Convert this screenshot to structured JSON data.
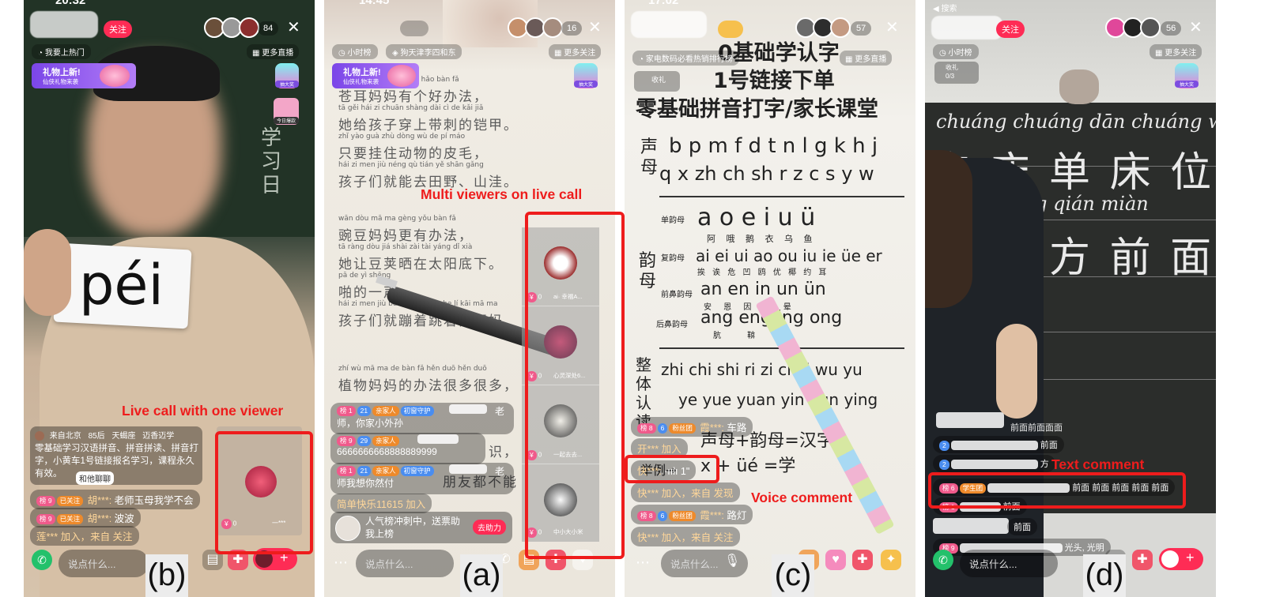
{
  "panel_b": {
    "status_time": "20:32",
    "follow": "关注",
    "viewer_count": "84",
    "trending": "我要上热门",
    "more_live": "更多直播",
    "gift_banner_title": "礼物上新!",
    "gift_banner_sub": "仙侠礼物来袭",
    "lottery": "抽大奖",
    "today_task": "今日爆款",
    "card_word": "péi",
    "label": "Live call with one viewer",
    "profile_tags": [
      "来自北京",
      "85后",
      "天蝎座",
      "迈香迈学"
    ],
    "intro_text": "零基础学习汉语拼音、拼音拼读、拼音打字，小黄车1号链接报名学习，课程永久有效。",
    "chat_with_him": "和他聊聊",
    "comments": [
      {
        "level": "9",
        "badge": "已关注",
        "user": "胡***:",
        "text": "老师玉母我学不会"
      },
      {
        "level": "9",
        "badge": "已关注",
        "user": "胡***:",
        "text": "波波"
      },
      {
        "user": "莲***",
        "text": "加入，来自 关注"
      }
    ],
    "call_tile_count": "0",
    "call_tile_name": "一***",
    "input_placeholder": "说点什么...",
    "subfig": "(b)"
  },
  "panel_a": {
    "status_time": "14:45",
    "viewer_count": "16",
    "tag1": "小时榜",
    "tag2": "狗天津李四和东",
    "more": "更多关注",
    "gift_banner_title": "礼物上新!",
    "gift_banner_sub": "仙侠礼物来袭",
    "lottery": "抽大奖",
    "book_lines": [
      {
        "pinyin": "cāng ěr  mā ma  yǒu gè  hǎo bàn fǎ",
        "text": "苍耳妈妈有个好办法，"
      },
      {
        "pinyin": "tā gěi hái zi chuān shàng dài cì de kǎi jiǎ",
        "text": "她给孩子穿上带刺的铠甲。"
      },
      {
        "pinyin": "zhǐ yào guà zhù dòng wù de pí máo",
        "text": "只要挂住动物的皮毛，"
      },
      {
        "pinyin": "hái zi men jiù néng qù tián yě  shān gǎng",
        "text": "孩子们就能去田野、山洼。"
      },
      {
        "pinyin": "wān dòu mā ma gèng yǒu bàn fǎ",
        "text": "豌豆妈妈更有办法，"
      },
      {
        "pinyin": "tā ràng dòu jiá shài zài tài yáng dǐ xià",
        "text": "她让豆荚晒在太阳底下。"
      },
      {
        "pinyin": "pā de yì shēng",
        "text": "啪的一声，"
      },
      {
        "pinyin": "hái zi men jiù bèng zhe tiào zhe lí kāi mā ma",
        "text": "孩子们就蹦着跳着离开妈"
      },
      {
        "pinyin": "zhí wù mā ma de bàn fǎ hěn duō hěn duō",
        "text": "植物妈妈的办法很多很多，"
      },
      {
        "pinyin": "",
        "text": "识，"
      },
      {
        "pinyin": "",
        "text": "朋友都不能"
      }
    ],
    "label": "Multi viewers on live call",
    "viewer_tiles": [
      {
        "count": "0",
        "name": "ai· 幸福A..."
      },
      {
        "count": "0",
        "name": "心灵深处6..."
      },
      {
        "count": "0",
        "name": "一起去去..."
      },
      {
        "count": "0",
        "name": "中小大小米"
      }
    ],
    "comments": [
      {
        "level": "1",
        "num": "21",
        "badge1": "亲家人",
        "badge2": "初窗守护",
        "tail": "老",
        "text2": "师，你家小外孙"
      },
      {
        "level": "9",
        "num": "29",
        "badge1": "亲家人",
        "text2": "6666666668888889999"
      },
      {
        "level": "1",
        "num": "21",
        "badge1": "亲家人",
        "badge2": "初窗守护",
        "tail": "老",
        "text2": "师我想你然付"
      },
      {
        "text": "简单快乐11615 加入"
      }
    ],
    "rank_banner_text": "人气榜冲刺中，送票助我上榜",
    "rank_banner_btn": "去助力",
    "input_placeholder": "说点什么...",
    "subfig": "(a)"
  },
  "panel_c": {
    "status_time": "17:02",
    "viewer_count": "57",
    "tag1": "家电数码必看热销排行榜",
    "more_live": "更多直播",
    "collect": "收礼",
    "title_line1": "0基础学认字",
    "title_line2": "1号链接下单",
    "title_line3": "零基础拼音打字/家长课堂",
    "sheng_label": "声母",
    "sheng_row1": "b p m f d t n l g k h j",
    "sheng_row2": "q x zh ch sh r z c s y w",
    "yun_label": "韵母",
    "dan_label": "单韵母",
    "dan_row": "a  o  e  i  u  ü",
    "dan_sub": "阿  哦  鹅  衣  乌  鱼",
    "fu_label": "复韵母",
    "fu_row": "ai ei ui ao ou iu ie üe er",
    "fu_sub": "挨 诶 危 凹 鸥 优 椰 约 耳",
    "qian_label": "前鼻韵母",
    "qian_row": "an  en  in  un  ün",
    "qian_sub": "安  恩  因  温  晕",
    "hou_label": "后鼻韵母",
    "hou_row": "ang  eng  ing  ong",
    "hou_sub": "肮  鞥  鹰",
    "zt_label": "整体认读",
    "zt_row1": "zhi chi shi ri zi ci   yi wu yu",
    "zt_row2": "ye yue yuan yin yun ying",
    "eq1": "声母+韵母=汉字",
    "eq2_left": "举例→",
    "eq2": "x  +  üé =学",
    "comments": [
      {
        "level": "8",
        "num": "6",
        "badge": "粉丝团",
        "user": "霞***:",
        "text": "车路"
      },
      {
        "text": "开*** 加入"
      },
      {
        "voice_user": "快***:",
        "voice_len": "1\""
      },
      {
        "text": "快*** 加入，来自 发现"
      },
      {
        "level": "8",
        "num": "6",
        "badge": "粉丝团",
        "user": "霞***:",
        "text": "路灯"
      },
      {
        "text": "快*** 加入，来自 关注"
      }
    ],
    "label": "Voice comment",
    "input_placeholder": "说点什么...",
    "subfig": "(c)"
  },
  "panel_d": {
    "status_time": "◀ 搜索",
    "follow": "关注",
    "viewer_count": "56",
    "tag1": "小时榜",
    "more": "更多关注",
    "collect_label": "收礼",
    "collect_progress": "0/3",
    "lottery": "抽大奖",
    "board_pinyin1": "chuáng chuáng dān chuáng wèi",
    "board_chars1": "床 床 单 床 位",
    "board_pinyin2": "qián fāng qián miàn",
    "board_chars2": "前 前 方 前 面",
    "board_pinyin3": "g",
    "comments_top": [
      "前面前面面面",
      "前面",
      "方"
    ],
    "comment_hl": {
      "level": "6",
      "badge": "学生团",
      "text": "前面 前面 前面 前面 前面"
    },
    "comment_2": {
      "level": "1",
      "text": "前面"
    },
    "comment_3": "前面",
    "comment_4": {
      "level": "9",
      "text": "光头, 光明"
    },
    "label": "Text comment",
    "input_placeholder": "说点什么...",
    "subfig": "(d)"
  }
}
